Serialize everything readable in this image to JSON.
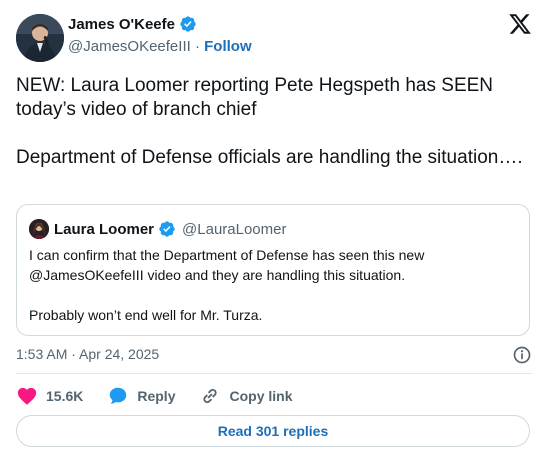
{
  "author": {
    "name": "James O'Keefe",
    "handle": "@JamesOKeefeIII",
    "separator": "·",
    "follow_label": "Follow"
  },
  "tweet": {
    "text": "NEW: Laura Loomer reporting Pete Hegspeth has SEEN today’s video of branch chief\n\nDepartment of Defense officials are handling the situation…."
  },
  "quote": {
    "name": "Laura Loomer",
    "handle": "@LauraLoomer",
    "text": "I can confirm that the Department of Defense has seen this new @JamesOKeefeIII video and they are handling this situation.\n\nProbably won’t end well for Mr. Turza."
  },
  "meta": {
    "timestamp": "1:53 AM · Apr 24, 2025"
  },
  "actions": {
    "like_count": "15.6K",
    "reply_label": "Reply",
    "copy_label": "Copy link"
  },
  "read_replies_label": "Read 301 replies",
  "colors": {
    "like": "#f91880",
    "reply": "#1d9bf0",
    "link": "#1d6fb8",
    "verified": "#1d9bf0"
  },
  "icons": [
    "verified-badge-icon",
    "x-logo-icon",
    "info-icon",
    "heart-icon",
    "reply-bubble-icon",
    "link-icon"
  ]
}
